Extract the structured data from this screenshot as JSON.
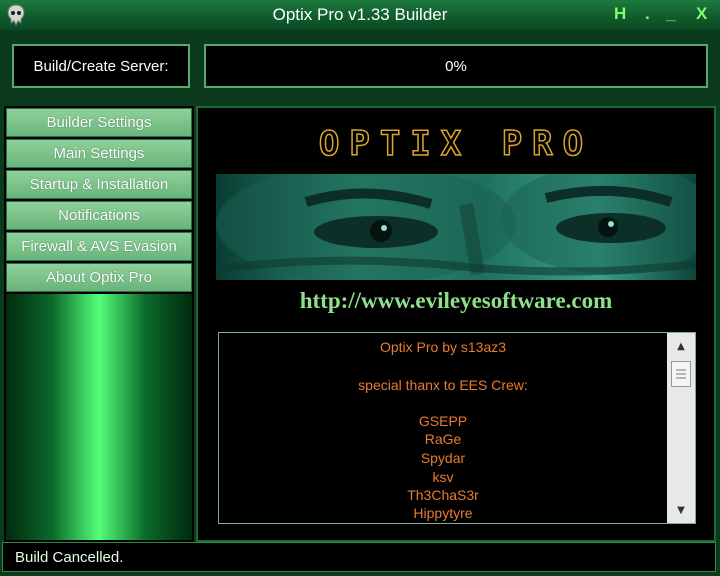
{
  "window": {
    "title": "Optix Pro v1.33 Builder",
    "controls": {
      "help": "H",
      "dot": ".",
      "minimize": "_",
      "close": "X"
    }
  },
  "build": {
    "label": "Build/Create Server:",
    "progress_text": "0%",
    "progress_value": 0
  },
  "sidebar": {
    "items": [
      {
        "label": "Builder Settings"
      },
      {
        "label": "Main Settings"
      },
      {
        "label": "Startup & Installation"
      },
      {
        "label": "Notifications"
      },
      {
        "label": "Firewall & AVS Evasion"
      },
      {
        "label": "About Optix Pro"
      }
    ]
  },
  "about": {
    "logo": "OPTIX PRO",
    "url": "http://www.evileyesoftware.com",
    "credits": [
      "Optix Pro by s13az3",
      "",
      "special thanx to EES Crew:",
      "",
      "GSEPP",
      "RaGe",
      "Spydar",
      "ksv",
      "Th3ChaS3r",
      "Hippytyre"
    ]
  },
  "status": {
    "text": "Build Cancelled."
  },
  "icons": {
    "app": "skull-icon",
    "scroll_up": "arrow-up-icon",
    "scroll_down": "arrow-down-icon"
  },
  "colors": {
    "accent_green": "#7dff6a",
    "credit_orange": "#e87b2f",
    "logo_gold": "#d7a62a",
    "url_green": "#8fe08a"
  }
}
